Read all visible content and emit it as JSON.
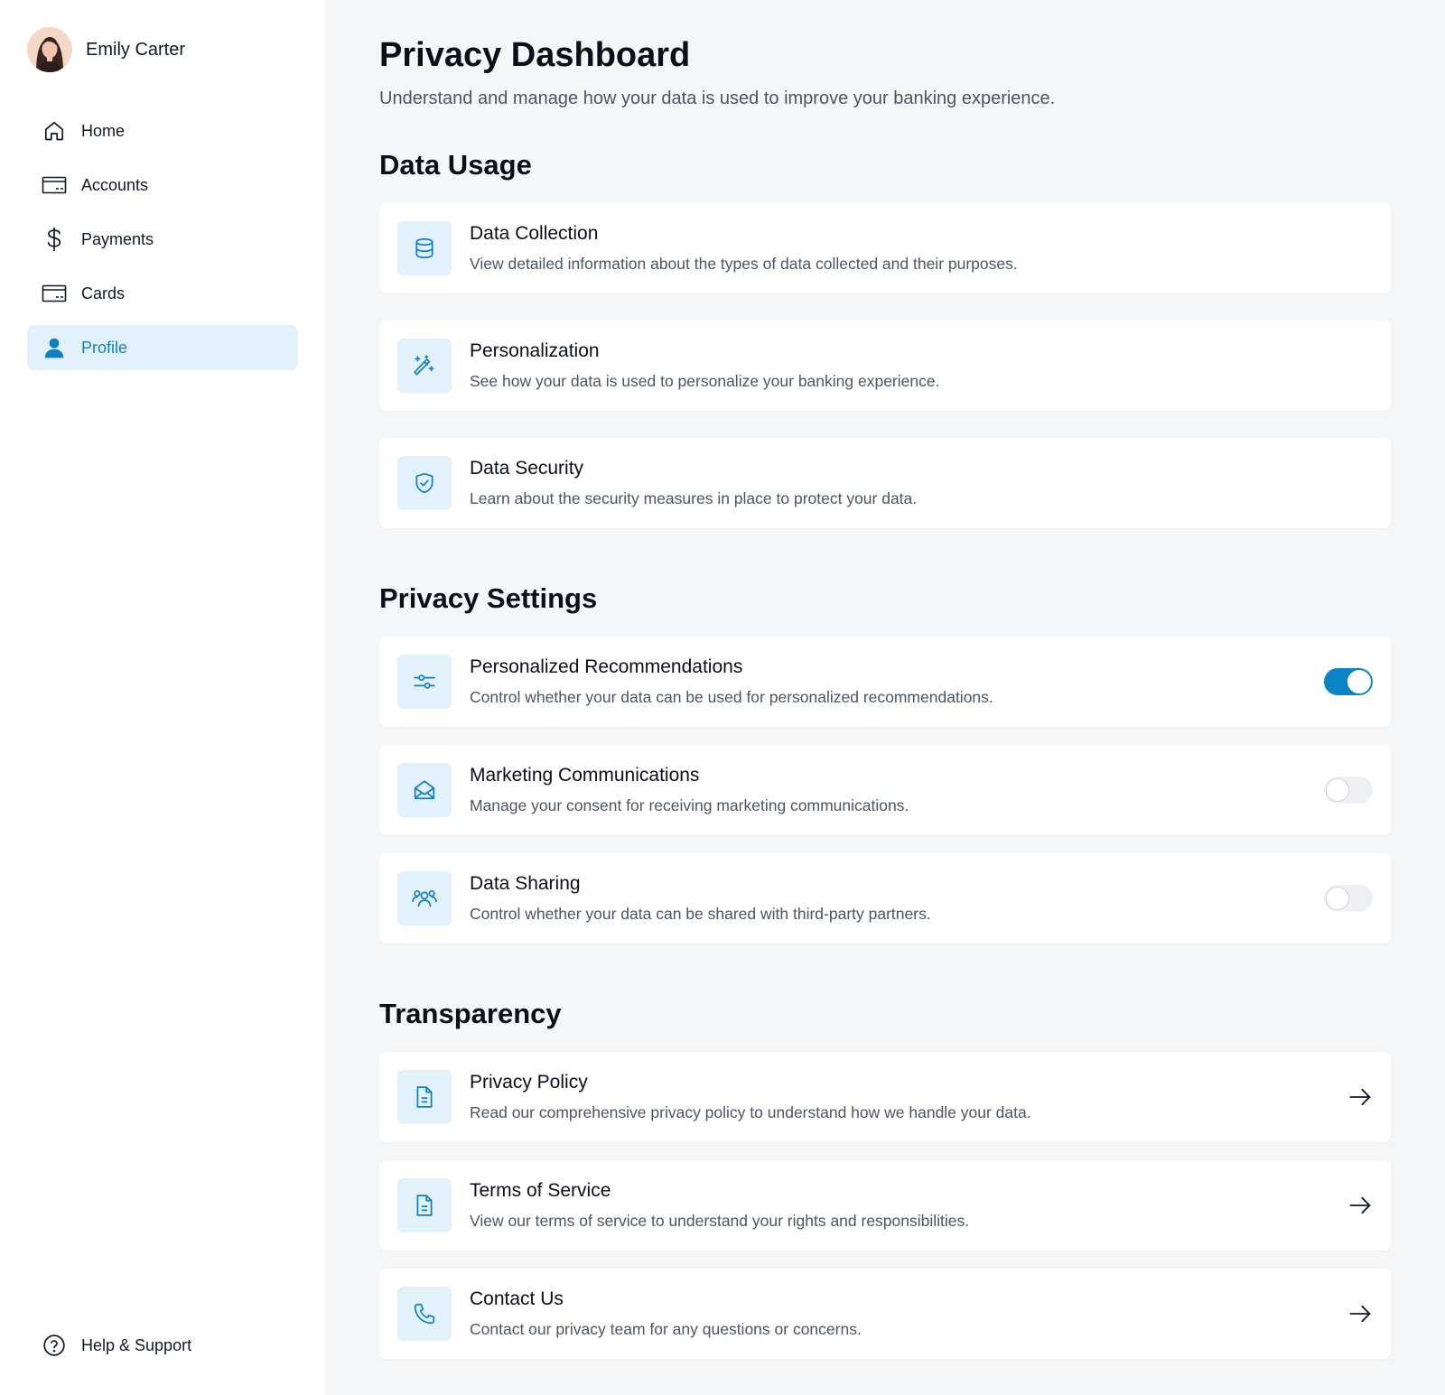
{
  "sidebar": {
    "user_name": "Emily Carter",
    "nav": [
      {
        "label": "Home",
        "icon": "home-icon"
      },
      {
        "label": "Accounts",
        "icon": "credit-card-icon"
      },
      {
        "label": "Payments",
        "icon": "dollar-icon"
      },
      {
        "label": "Cards",
        "icon": "credit-card-icon"
      },
      {
        "label": "Profile",
        "icon": "user-icon",
        "active": true
      }
    ],
    "help_label": "Help & Support"
  },
  "header": {
    "title": "Privacy Dashboard",
    "subtitle": "Understand and manage how your data is used to improve your banking experience."
  },
  "sections": {
    "data_usage": {
      "title": "Data Usage",
      "items": [
        {
          "title": "Data Collection",
          "description": "View detailed information about the types of data collected and their purposes.",
          "icon": "database-icon"
        },
        {
          "title": "Personalization",
          "description": "See how your data is used to personalize your banking experience.",
          "icon": "magic-wand-icon"
        },
        {
          "title": "Data Security",
          "description": "Learn about the security measures in place to protect your data.",
          "icon": "shield-check-icon"
        }
      ]
    },
    "privacy_settings": {
      "title": "Privacy Settings",
      "items": [
        {
          "title": "Personalized Recommendations",
          "description": "Control whether your data can be used for personalized recommendations.",
          "icon": "sliders-icon",
          "enabled": true
        },
        {
          "title": "Marketing Communications",
          "description": "Manage your consent for receiving marketing communications.",
          "icon": "envelope-open-icon",
          "enabled": false
        },
        {
          "title": "Data Sharing",
          "description": "Control whether your data can be shared with third-party partners.",
          "icon": "users-icon",
          "enabled": false
        }
      ]
    },
    "transparency": {
      "title": "Transparency",
      "items": [
        {
          "title": "Privacy Policy",
          "description": "Read our comprehensive privacy policy to understand how we handle your data.",
          "icon": "document-icon"
        },
        {
          "title": "Terms of Service",
          "description": "View our terms of service to understand your rights and responsibilities.",
          "icon": "document-icon"
        },
        {
          "title": "Contact Us",
          "description": "Contact our privacy team for any questions or concerns.",
          "icon": "phone-icon"
        }
      ]
    }
  },
  "colors": {
    "accent": "#0b84c6",
    "active_bg": "#e3f1fb",
    "page_bg": "#f5f6f8"
  }
}
